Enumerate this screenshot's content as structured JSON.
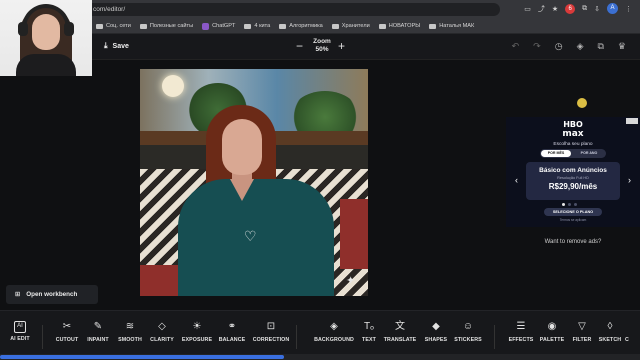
{
  "browser": {
    "url": "com/editor/",
    "bookmarks": [
      "Соц. сети",
      "Полезные сайты",
      "ChatGPT",
      "4 кита",
      "Алгоритмика",
      "Хранители",
      "НОВАТОРЫ",
      "Наталья МАК"
    ],
    "ext_badge": "6",
    "avatar_letter": "A"
  },
  "toolbar": {
    "save_label": "Save",
    "zoom_label": "Zoom",
    "zoom_value": "50%",
    "vip_label": "VIP"
  },
  "ad": {
    "brand_line1": "HBO",
    "brand_line2": "max",
    "choose_plan": "Escolha seu plano",
    "tab_month": "POR MÊS",
    "tab_year": "POR ANO",
    "plan_name": "Básico com Anúncios",
    "resolution": "Resolução Full HD",
    "price": "R$29,90/mês",
    "cta": "SELECIONE O PLANO",
    "terms": "Termos se aplicam"
  },
  "remove_ads": "Want to remove ads?",
  "workbench_label": "Open workbench",
  "tools": [
    {
      "icon": "AI",
      "label": "AI EDIT"
    },
    {
      "icon": "✂",
      "label": "CUTOUT"
    },
    {
      "icon": "✎",
      "label": "INPAINT"
    },
    {
      "icon": "≋",
      "label": "SMOOTH"
    },
    {
      "icon": "◇",
      "label": "CLARITY"
    },
    {
      "icon": "☀",
      "label": "EXPOSURE"
    },
    {
      "icon": "⚭",
      "label": "BALANCE"
    },
    {
      "icon": "⊡",
      "label": "CORRECTION"
    },
    {
      "icon": "◈",
      "label": "BACKGROUND"
    },
    {
      "icon": "Tₒ",
      "label": "TEXT"
    },
    {
      "icon": "文",
      "label": "TRANSLATE"
    },
    {
      "icon": "◆",
      "label": "SHAPES"
    },
    {
      "icon": "☺",
      "label": "STICKERS"
    },
    {
      "icon": "☰",
      "label": "EFFECTS"
    },
    {
      "icon": "◉",
      "label": "PALETTE"
    },
    {
      "icon": "▽",
      "label": "FILTER"
    },
    {
      "icon": "◊",
      "label": "SKETCH"
    },
    {
      "icon": "",
      "label": "C"
    }
  ]
}
